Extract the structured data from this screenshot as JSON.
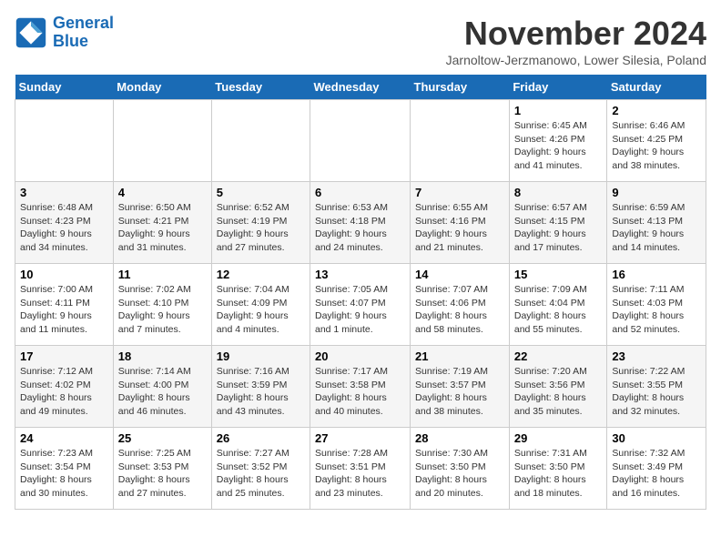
{
  "logo": {
    "line1": "General",
    "line2": "Blue"
  },
  "title": "November 2024",
  "subtitle": "Jarnoltow-Jerzmanowo, Lower Silesia, Poland",
  "days_of_week": [
    "Sunday",
    "Monday",
    "Tuesday",
    "Wednesday",
    "Thursday",
    "Friday",
    "Saturday"
  ],
  "weeks": [
    [
      {
        "day": "",
        "info": ""
      },
      {
        "day": "",
        "info": ""
      },
      {
        "day": "",
        "info": ""
      },
      {
        "day": "",
        "info": ""
      },
      {
        "day": "",
        "info": ""
      },
      {
        "day": "1",
        "info": "Sunrise: 6:45 AM\nSunset: 4:26 PM\nDaylight: 9 hours and 41 minutes."
      },
      {
        "day": "2",
        "info": "Sunrise: 6:46 AM\nSunset: 4:25 PM\nDaylight: 9 hours and 38 minutes."
      }
    ],
    [
      {
        "day": "3",
        "info": "Sunrise: 6:48 AM\nSunset: 4:23 PM\nDaylight: 9 hours and 34 minutes."
      },
      {
        "day": "4",
        "info": "Sunrise: 6:50 AM\nSunset: 4:21 PM\nDaylight: 9 hours and 31 minutes."
      },
      {
        "day": "5",
        "info": "Sunrise: 6:52 AM\nSunset: 4:19 PM\nDaylight: 9 hours and 27 minutes."
      },
      {
        "day": "6",
        "info": "Sunrise: 6:53 AM\nSunset: 4:18 PM\nDaylight: 9 hours and 24 minutes."
      },
      {
        "day": "7",
        "info": "Sunrise: 6:55 AM\nSunset: 4:16 PM\nDaylight: 9 hours and 21 minutes."
      },
      {
        "day": "8",
        "info": "Sunrise: 6:57 AM\nSunset: 4:15 PM\nDaylight: 9 hours and 17 minutes."
      },
      {
        "day": "9",
        "info": "Sunrise: 6:59 AM\nSunset: 4:13 PM\nDaylight: 9 hours and 14 minutes."
      }
    ],
    [
      {
        "day": "10",
        "info": "Sunrise: 7:00 AM\nSunset: 4:11 PM\nDaylight: 9 hours and 11 minutes."
      },
      {
        "day": "11",
        "info": "Sunrise: 7:02 AM\nSunset: 4:10 PM\nDaylight: 9 hours and 7 minutes."
      },
      {
        "day": "12",
        "info": "Sunrise: 7:04 AM\nSunset: 4:09 PM\nDaylight: 9 hours and 4 minutes."
      },
      {
        "day": "13",
        "info": "Sunrise: 7:05 AM\nSunset: 4:07 PM\nDaylight: 9 hours and 1 minute."
      },
      {
        "day": "14",
        "info": "Sunrise: 7:07 AM\nSunset: 4:06 PM\nDaylight: 8 hours and 58 minutes."
      },
      {
        "day": "15",
        "info": "Sunrise: 7:09 AM\nSunset: 4:04 PM\nDaylight: 8 hours and 55 minutes."
      },
      {
        "day": "16",
        "info": "Sunrise: 7:11 AM\nSunset: 4:03 PM\nDaylight: 8 hours and 52 minutes."
      }
    ],
    [
      {
        "day": "17",
        "info": "Sunrise: 7:12 AM\nSunset: 4:02 PM\nDaylight: 8 hours and 49 minutes."
      },
      {
        "day": "18",
        "info": "Sunrise: 7:14 AM\nSunset: 4:00 PM\nDaylight: 8 hours and 46 minutes."
      },
      {
        "day": "19",
        "info": "Sunrise: 7:16 AM\nSunset: 3:59 PM\nDaylight: 8 hours and 43 minutes."
      },
      {
        "day": "20",
        "info": "Sunrise: 7:17 AM\nSunset: 3:58 PM\nDaylight: 8 hours and 40 minutes."
      },
      {
        "day": "21",
        "info": "Sunrise: 7:19 AM\nSunset: 3:57 PM\nDaylight: 8 hours and 38 minutes."
      },
      {
        "day": "22",
        "info": "Sunrise: 7:20 AM\nSunset: 3:56 PM\nDaylight: 8 hours and 35 minutes."
      },
      {
        "day": "23",
        "info": "Sunrise: 7:22 AM\nSunset: 3:55 PM\nDaylight: 8 hours and 32 minutes."
      }
    ],
    [
      {
        "day": "24",
        "info": "Sunrise: 7:23 AM\nSunset: 3:54 PM\nDaylight: 8 hours and 30 minutes."
      },
      {
        "day": "25",
        "info": "Sunrise: 7:25 AM\nSunset: 3:53 PM\nDaylight: 8 hours and 27 minutes."
      },
      {
        "day": "26",
        "info": "Sunrise: 7:27 AM\nSunset: 3:52 PM\nDaylight: 8 hours and 25 minutes."
      },
      {
        "day": "27",
        "info": "Sunrise: 7:28 AM\nSunset: 3:51 PM\nDaylight: 8 hours and 23 minutes."
      },
      {
        "day": "28",
        "info": "Sunrise: 7:30 AM\nSunset: 3:50 PM\nDaylight: 8 hours and 20 minutes."
      },
      {
        "day": "29",
        "info": "Sunrise: 7:31 AM\nSunset: 3:50 PM\nDaylight: 8 hours and 18 minutes."
      },
      {
        "day": "30",
        "info": "Sunrise: 7:32 AM\nSunset: 3:49 PM\nDaylight: 8 hours and 16 minutes."
      }
    ]
  ]
}
